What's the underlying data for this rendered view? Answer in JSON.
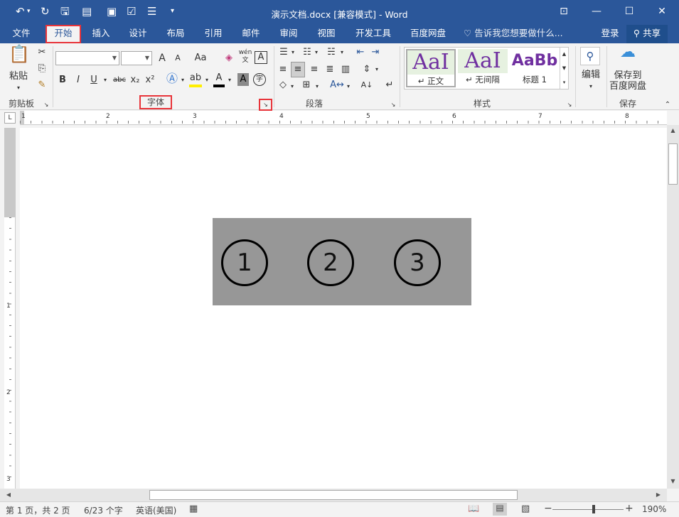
{
  "window": {
    "title": "演示文档.docx [兼容模式] - Word"
  },
  "qat": {
    "undo": "↶",
    "redo": "↻",
    "save": "🖫"
  },
  "tabs": [
    {
      "label": "文件"
    },
    {
      "label": "开始"
    },
    {
      "label": "插入"
    },
    {
      "label": "设计"
    },
    {
      "label": "布局"
    },
    {
      "label": "引用"
    },
    {
      "label": "邮件"
    },
    {
      "label": "审阅"
    },
    {
      "label": "视图"
    },
    {
      "label": "开发工具"
    },
    {
      "label": "百度网盘"
    }
  ],
  "tellme": "告诉我您想要做什么...",
  "account": {
    "login": "登录",
    "share": "共享"
  },
  "ribbon": {
    "clipboard": {
      "paste": "粘贴",
      "group": "剪贴板"
    },
    "font": {
      "group": "字体",
      "bold": "B",
      "italic": "I",
      "underline": "U",
      "strike": "abc",
      "sub": "x₂",
      "sup": "x²",
      "grow": "A",
      "shrink": "A",
      "aa": "Aa",
      "wen": "wén",
      "wen2": "文"
    },
    "paragraph": {
      "group": "段落"
    },
    "styles": {
      "group": "样式",
      "items": [
        {
          "sample": "AaI",
          "name": "↵ 正文"
        },
        {
          "sample": "AaI",
          "name": "↵ 无间隔"
        },
        {
          "sample": "AaBb",
          "name": "标题 1"
        }
      ]
    },
    "editing": {
      "label": "编辑"
    },
    "save": {
      "label1": "保存到",
      "label2": "百度网盘",
      "group": "保存"
    }
  },
  "ruler": {
    "numbers": [
      "1",
      "2",
      "3",
      "4",
      "5",
      "6",
      "7",
      "8"
    ]
  },
  "vruler": {
    "numbers": [
      "1",
      "2",
      "3"
    ]
  },
  "document": {
    "circles": [
      "1",
      "2",
      "3"
    ]
  },
  "status": {
    "page": "第 1 页，共 2 页",
    "words": "6/23 个字",
    "lang": "英语(美国)",
    "zoom": "190%"
  }
}
